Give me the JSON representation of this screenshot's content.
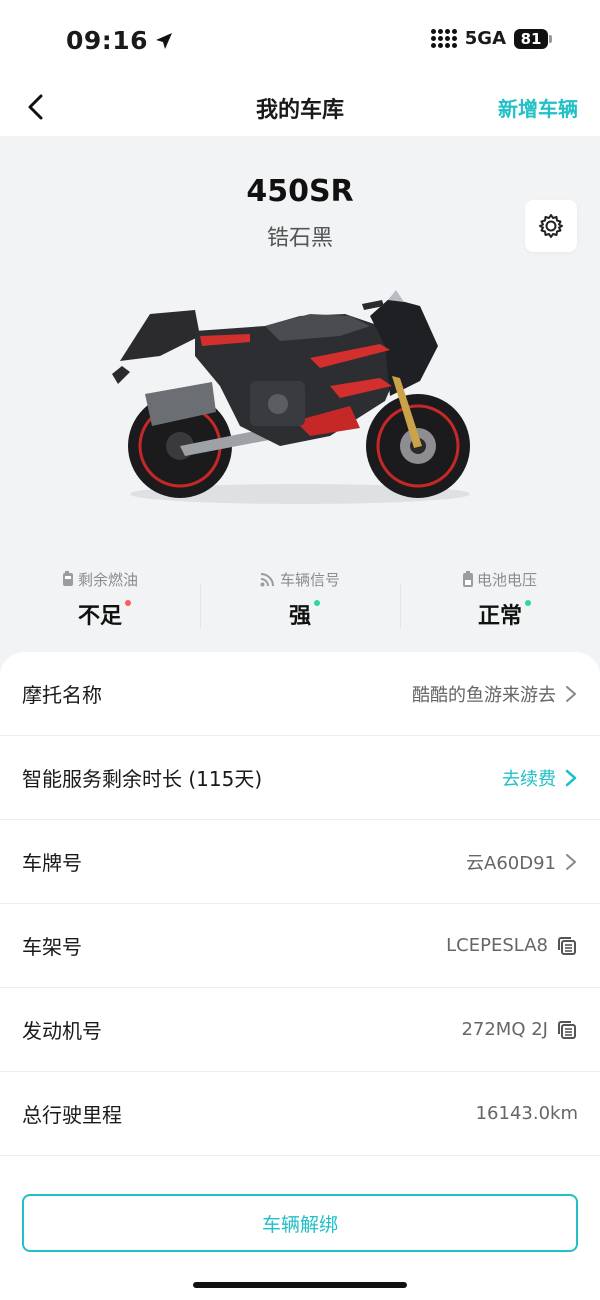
{
  "status_bar": {
    "time": "09:16",
    "network": "5GA",
    "battery": "81"
  },
  "nav": {
    "title": "我的车库",
    "add_label": "新增车辆"
  },
  "vehicle": {
    "model": "450SR",
    "color_name": "锆石黑"
  },
  "stats": [
    {
      "label": "剩余燃油",
      "value": "不足",
      "icon": "fuel-icon",
      "status_color": "#ff5a5a"
    },
    {
      "label": "车辆信号",
      "value": "强",
      "icon": "signal-icon",
      "status_color": "#2fd6a0"
    },
    {
      "label": "电池电压",
      "value": "正常",
      "icon": "battery-icon",
      "status_color": "#2fd6a0"
    }
  ],
  "rows": {
    "name": {
      "label": "摩托名称",
      "value": "酷酷的鱼游来游去"
    },
    "service": {
      "label": "智能服务剩余时长 (115天)",
      "value": "去续费"
    },
    "plate": {
      "label": "车牌号",
      "value": "云A60D91"
    },
    "frame": {
      "label": "车架号",
      "value": "LCEPESLA8"
    },
    "engine": {
      "label": "发动机号",
      "value": "272MQ 2J"
    },
    "mileage": {
      "label": "总行驶里程",
      "value": "16143.0km"
    }
  },
  "unbind_label": "车辆解绑",
  "colors": {
    "accent": "#20c0c6",
    "warning": "#ff5a5a",
    "ok": "#2fd6a0"
  }
}
